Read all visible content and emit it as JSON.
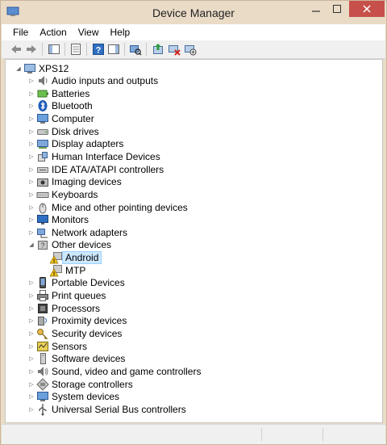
{
  "window": {
    "title": "Device Manager"
  },
  "menu": [
    "File",
    "Action",
    "View",
    "Help"
  ],
  "toolbar": [
    "back-icon",
    "forward-icon",
    "show-hide-console-tree-icon",
    "properties-icon",
    "help-icon",
    "action-pane-icon",
    "scan-hardware-changes-icon",
    "update-driver-icon",
    "uninstall-device-icon",
    "disable-device-icon"
  ],
  "tree": {
    "root": "XPS12",
    "categories": [
      {
        "label": "Audio inputs and outputs",
        "icon": "speaker-icon",
        "expanded": false
      },
      {
        "label": "Batteries",
        "icon": "battery-icon",
        "expanded": false
      },
      {
        "label": "Bluetooth",
        "icon": "bluetooth-icon",
        "expanded": false
      },
      {
        "label": "Computer",
        "icon": "computer-icon",
        "expanded": false
      },
      {
        "label": "Disk drives",
        "icon": "disk-drive-icon",
        "expanded": false
      },
      {
        "label": "Display adapters",
        "icon": "display-adapter-icon",
        "expanded": false
      },
      {
        "label": "Human Interface Devices",
        "icon": "hid-icon",
        "expanded": false
      },
      {
        "label": "IDE ATA/ATAPI controllers",
        "icon": "ide-controller-icon",
        "expanded": false
      },
      {
        "label": "Imaging devices",
        "icon": "camera-icon",
        "expanded": false
      },
      {
        "label": "Keyboards",
        "icon": "keyboard-icon",
        "expanded": false
      },
      {
        "label": "Mice and other pointing devices",
        "icon": "mouse-icon",
        "expanded": false
      },
      {
        "label": "Monitors",
        "icon": "monitor-icon",
        "expanded": false
      },
      {
        "label": "Network adapters",
        "icon": "network-adapter-icon",
        "expanded": false
      },
      {
        "label": "Other devices",
        "icon": "other-devices-icon",
        "expanded": true,
        "children": [
          {
            "label": "Android",
            "icon": "warning-device-icon",
            "selected": true
          },
          {
            "label": "MTP",
            "icon": "warning-device-icon",
            "selected": false
          }
        ]
      },
      {
        "label": "Portable Devices",
        "icon": "portable-device-icon",
        "expanded": false
      },
      {
        "label": "Print queues",
        "icon": "printer-icon",
        "expanded": false
      },
      {
        "label": "Processors",
        "icon": "processor-icon",
        "expanded": false
      },
      {
        "label": "Proximity devices",
        "icon": "proximity-icon",
        "expanded": false
      },
      {
        "label": "Security devices",
        "icon": "security-key-icon",
        "expanded": false
      },
      {
        "label": "Sensors",
        "icon": "sensor-icon",
        "expanded": false
      },
      {
        "label": "Software devices",
        "icon": "software-device-icon",
        "expanded": false
      },
      {
        "label": "Sound, video and game controllers",
        "icon": "sound-icon",
        "expanded": false
      },
      {
        "label": "Storage controllers",
        "icon": "storage-controller-icon",
        "expanded": false
      },
      {
        "label": "System devices",
        "icon": "system-device-icon",
        "expanded": false
      },
      {
        "label": "Universal Serial Bus controllers",
        "icon": "usb-icon",
        "expanded": false
      }
    ]
  },
  "colors": {
    "titlebar": "#e9dbc6",
    "close_button": "#c7504a",
    "selection_bg": "#cce8ff",
    "selection_border": "#99d1ff"
  }
}
